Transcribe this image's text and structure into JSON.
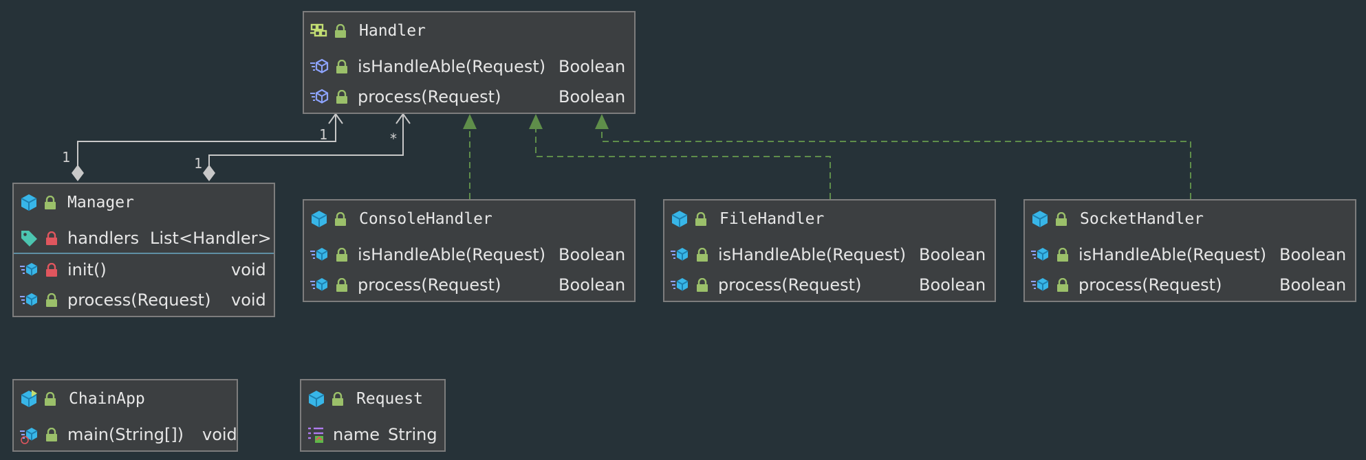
{
  "handler": {
    "name": "Handler",
    "methods": [
      {
        "name": "isHandleAble(Request)",
        "type": "Boolean"
      },
      {
        "name": "process(Request)",
        "type": "Boolean"
      }
    ]
  },
  "manager": {
    "name": "Manager",
    "field": {
      "name": "handlers",
      "type": "List<Handler>"
    },
    "methods": [
      {
        "name": "init()",
        "type": "void"
      },
      {
        "name": "process(Request)",
        "type": "void"
      }
    ]
  },
  "console_handler": {
    "name": "ConsoleHandler",
    "methods": [
      {
        "name": "isHandleAble(Request)",
        "type": "Boolean"
      },
      {
        "name": "process(Request)",
        "type": "Boolean"
      }
    ]
  },
  "file_handler": {
    "name": "FileHandler",
    "methods": [
      {
        "name": "isHandleAble(Request)",
        "type": "Boolean"
      },
      {
        "name": "process(Request)",
        "type": "Boolean"
      }
    ]
  },
  "socket_handler": {
    "name": "SocketHandler",
    "methods": [
      {
        "name": "isHandleAble(Request)",
        "type": "Boolean"
      },
      {
        "name": "process(Request)",
        "type": "Boolean"
      }
    ]
  },
  "chain_app": {
    "name": "ChainApp",
    "methods": [
      {
        "name": "main(String[])",
        "type": "void"
      }
    ]
  },
  "request": {
    "name": "Request",
    "field": {
      "name": "name",
      "type": "String"
    }
  },
  "relations": {
    "manager_mult_a": "1",
    "handler_mult_a": "1",
    "manager_mult_b": "1",
    "handler_mult_b": "*"
  },
  "colors": {
    "background": "#263238",
    "box": "#3c3f41",
    "lock_green": "#9bc06a",
    "lock_red": "#e0565e",
    "class_icon": "#38b6e8",
    "impl_arrow": "#5f8e4a"
  }
}
